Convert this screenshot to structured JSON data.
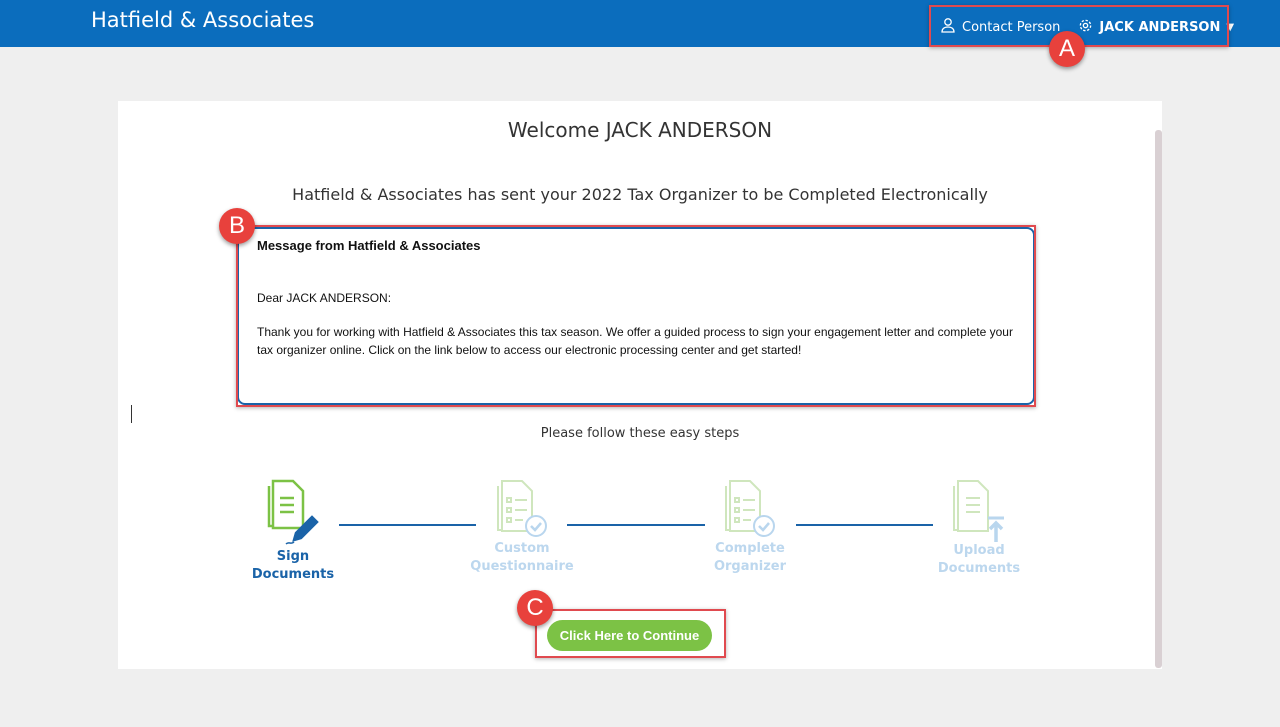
{
  "header": {
    "brand": "Hatfield & Associates",
    "contact": "Contact Person",
    "user": "JACK ANDERSON"
  },
  "main": {
    "welcome": "Welcome JACK ANDERSON",
    "subtitle": "Hatfield & Associates has sent your 2022 Tax Organizer to be Completed Electronically",
    "message": {
      "title": "Message from Hatfield & Associates",
      "greeting": "Dear JACK  ANDERSON:",
      "body": "Thank you for working with Hatfield & Associates  this tax season. We offer a guided process to sign your engagement letter and complete your tax organizer online.  Click on the link below to access our electronic processing center and get started!"
    },
    "steps_intro": "Please follow these easy steps",
    "steps": [
      {
        "line1": "Sign",
        "line2": "Documents"
      },
      {
        "line1": "Custom",
        "line2": "Questionnaire"
      },
      {
        "line1": "Complete",
        "line2": "Organizer"
      },
      {
        "line1": "Upload",
        "line2": "Documents"
      }
    ],
    "continue": "Click Here to Continue"
  },
  "annotations": [
    "A",
    "B",
    "C"
  ],
  "colors": {
    "header": "#0b6dbd",
    "accent_green": "#7cc245",
    "annotation": "#e8413c"
  }
}
